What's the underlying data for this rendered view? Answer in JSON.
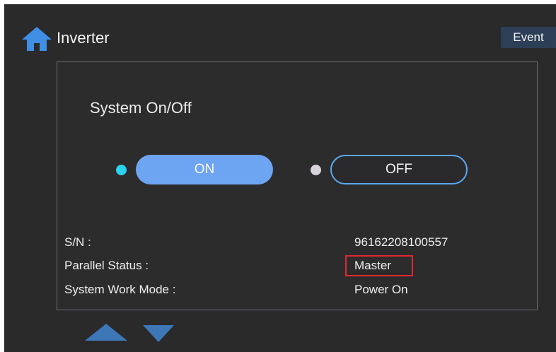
{
  "header": {
    "title": "Inverter",
    "event_label": "Event",
    "home_icon": "home-icon"
  },
  "panel": {
    "section_title": "System On/Off",
    "on_label": "ON",
    "off_label": "OFF",
    "on_indicator_color": "#2bd3ee",
    "off_indicator_color": "#d8d4dc"
  },
  "info": {
    "sn_label": "S/N :",
    "sn_value": "96162208100557",
    "parallel_label": "Parallel Status :",
    "parallel_value": "Master",
    "mode_label": "System Work Mode :",
    "mode_value": "Power On"
  },
  "nav": {
    "up_icon": "triangle-up-icon",
    "down_icon": "triangle-down-icon"
  },
  "colors": {
    "background": "#2a2a2b",
    "accent_blue": "#6ea5f2",
    "home_icon": "#3f8fe6",
    "event_button": "#2d3e57",
    "highlight": "#e0282c"
  }
}
